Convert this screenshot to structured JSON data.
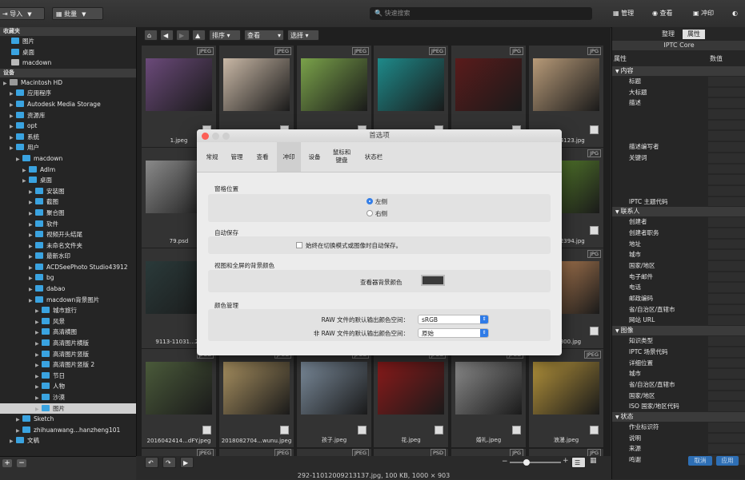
{
  "toolbar": {
    "import_label": "导入",
    "batch_label": "批量",
    "search_placeholder": "快速搜索",
    "modes": [
      "管理",
      "查看",
      "冲印"
    ]
  },
  "left": {
    "favorites_header": "收藏夹",
    "favorites": [
      "图片",
      "桌面",
      "macdown"
    ],
    "devices_header": "设备",
    "tree": [
      {
        "label": "Macintosh HD",
        "indent": 1
      },
      {
        "label": "应用程序",
        "indent": 2
      },
      {
        "label": "Autodesk Media Storage",
        "indent": 2
      },
      {
        "label": "资源库",
        "indent": 2
      },
      {
        "label": "opt",
        "indent": 2
      },
      {
        "label": "系统",
        "indent": 2
      },
      {
        "label": "用户",
        "indent": 2
      },
      {
        "label": "macdown",
        "indent": 3
      },
      {
        "label": "Adlm",
        "indent": 4
      },
      {
        "label": "桌面",
        "indent": 4
      },
      {
        "label": "安装图",
        "indent": 5
      },
      {
        "label": "截图",
        "indent": 5
      },
      {
        "label": "聚合图",
        "indent": 5
      },
      {
        "label": "软件",
        "indent": 5
      },
      {
        "label": "视频开头结尾",
        "indent": 5
      },
      {
        "label": "未命名文件夹",
        "indent": 5
      },
      {
        "label": "最新水印",
        "indent": 5
      },
      {
        "label": "ACDSeePhoto Studio43912",
        "indent": 5
      },
      {
        "label": "bg",
        "indent": 5
      },
      {
        "label": "dabao",
        "indent": 5
      },
      {
        "label": "macdown背景图片",
        "indent": 5
      },
      {
        "label": "城市旅行",
        "indent": 6
      },
      {
        "label": "风景",
        "indent": 6
      },
      {
        "label": "高清横图",
        "indent": 6
      },
      {
        "label": "高清图片横版",
        "indent": 6
      },
      {
        "label": "高清图片竖版",
        "indent": 6
      },
      {
        "label": "高清图片竖版 2",
        "indent": 6
      },
      {
        "label": "节日",
        "indent": 6
      },
      {
        "label": "人物",
        "indent": 6
      },
      {
        "label": "沙漠",
        "indent": 6
      },
      {
        "label": "图片",
        "indent": 6,
        "selected": true
      },
      {
        "label": "Sketch",
        "indent": 3
      },
      {
        "label": "zhihuanwang...hanzheng101",
        "indent": 3
      },
      {
        "label": "文稿",
        "indent": 2
      }
    ]
  },
  "nav": {
    "sort": "排序",
    "view": "查看",
    "select": "选择"
  },
  "grid": {
    "rows": [
      [
        {
          "badge": "JPEG",
          "name": "1.jpeg",
          "color": "#6b4a7a"
        },
        {
          "badge": "JPEG",
          "name": "",
          "color": "#c9b8a6"
        },
        {
          "badge": "JPEG",
          "name": "",
          "color": "#7aa24a"
        },
        {
          "badge": "JPEG",
          "name": "",
          "color": "#1e8a8a"
        },
        {
          "badge": "JPG",
          "name": "",
          "color": "#5a1b1b"
        },
        {
          "badge": "JPG",
          "name": "61...4123.jpg",
          "color": "#b79a78"
        }
      ],
      [
        {
          "badge": "",
          "name": "79.psd",
          "color": "#8a8a8a"
        },
        {
          "badge": "",
          "name": "",
          "color": ""
        },
        {
          "badge": "",
          "name": "",
          "color": ""
        },
        {
          "badge": "",
          "name": "",
          "color": ""
        },
        {
          "badge": "",
          "name": "",
          "color": ""
        },
        {
          "badge": "JPG",
          "name": "42...2394.jpg",
          "color": "#5e8c2e"
        }
      ],
      [
        {
          "badge": "",
          "name": "9113-11031...27",
          "color": "#2a3a3a"
        },
        {
          "badge": "",
          "name": "",
          "color": ""
        },
        {
          "badge": "",
          "name": "",
          "color": ""
        },
        {
          "badge": "",
          "name": "",
          "color": ""
        },
        {
          "badge": "",
          "name": "",
          "color": ""
        },
        {
          "badge": "JPG",
          "name": "...x800.jpg",
          "color": "#c58a5a"
        }
      ],
      [
        {
          "badge": "JPEG",
          "name": "2016042414...dFY.jpeg",
          "color": "#4a5a3a"
        },
        {
          "badge": "JPEG",
          "name": "2018082704...wunu.jpeg",
          "color": "#a89060"
        },
        {
          "badge": "JPEG",
          "name": "孩子.jpeg",
          "color": "#7a8a9a"
        },
        {
          "badge": "JPEG",
          "name": "花.jpeg",
          "color": "#8a1a1a"
        },
        {
          "badge": "JPEG",
          "name": "婚礼.jpeg",
          "color": "#8a8a8a"
        },
        {
          "badge": "JPEG",
          "name": "浪漫.jpeg",
          "color": "#b0903a"
        }
      ]
    ],
    "bottom_badges": [
      "JPEG",
      "JPEG",
      "JPEG",
      "PSD",
      "JPG",
      "JPG"
    ]
  },
  "statusbar": {
    "text": "292-11012009213137.jpg, 100 KB, 1000 × 903"
  },
  "right": {
    "tabs": [
      "整理",
      "属性"
    ],
    "panel_title": "IPTC Core",
    "col_property": "属性",
    "col_value": "数值",
    "sections": [
      {
        "title": "内容",
        "rows": [
          "标题",
          "大标题",
          "描述",
          "",
          "",
          "",
          "描述编写者",
          "关键词",
          "",
          "",
          "",
          "IPTC 主题代码"
        ]
      },
      {
        "title": "联系人",
        "rows": [
          "创建者",
          "创建者职务",
          "地址",
          "城市",
          "国家/地区",
          "电子邮件",
          "电话",
          "邮政编码",
          "省/自治区/直辖市",
          "网站 URL"
        ]
      },
      {
        "title": "图像",
        "rows": [
          "知识类型",
          "IPTC 场景代码",
          "详细位置",
          "城市",
          "省/自治区/直辖市",
          "国家/地区",
          "ISO 国家/地区代码"
        ]
      },
      {
        "title": "状态",
        "rows": [
          "作业标识符",
          "说明",
          "来源",
          "鸣谢"
        ]
      }
    ],
    "cancel_label": "取消",
    "apply_label": "应用"
  },
  "dialog": {
    "title": "首选项",
    "tabs": [
      "常规",
      "管理",
      "查看",
      "冲印",
      "设备",
      "鼠标和\n键盘",
      "状态栏"
    ],
    "active_tab": "冲印",
    "window_position_label": "窗格位置",
    "left_option": "左侧",
    "right_option": "右侧",
    "autosave_label": "自动保存",
    "autosave_checkbox": "始终在切换模式或图像时自动保存。",
    "bg_color_label": "视图和全屏的背景颜色",
    "viewer_bg_label": "查看器背景颜色",
    "viewer_bg_color": "#3a3a3a",
    "color_mgmt_label": "颜色管理",
    "raw_label": "RAW 文件的默认输出颜色空间：",
    "raw_value": "sRGB",
    "nonraw_label": "非 RAW 文件的默认输出颜色空间：",
    "nonraw_value": "原始"
  }
}
